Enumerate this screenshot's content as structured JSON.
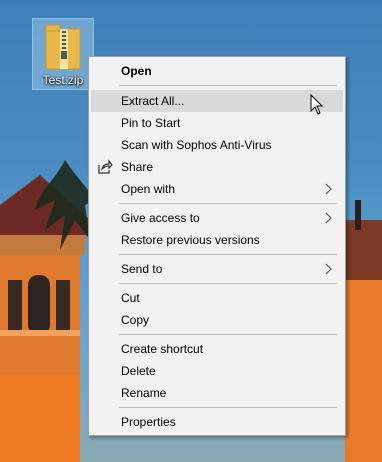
{
  "desktop": {
    "file": {
      "name": "Test.zip",
      "icon": "zip-folder-icon"
    }
  },
  "context_menu": {
    "items": [
      {
        "label": "Open",
        "bold": true
      },
      {
        "label": "Extract All...",
        "hover": true
      },
      {
        "label": "Pin to Start"
      },
      {
        "label": "Scan with Sophos Anti-Virus"
      },
      {
        "label": "Share",
        "icon": "share-icon"
      },
      {
        "label": "Open with",
        "submenu": true
      },
      {
        "label": "Give access to",
        "submenu": true
      },
      {
        "label": "Restore previous versions"
      },
      {
        "label": "Send to",
        "submenu": true
      },
      {
        "label": "Cut"
      },
      {
        "label": "Copy"
      },
      {
        "label": "Create shortcut"
      },
      {
        "label": "Delete"
      },
      {
        "label": "Rename"
      },
      {
        "label": "Properties"
      }
    ]
  },
  "colors": {
    "menu_bg": "#f2f2f2",
    "hover_bg": "#dadada",
    "separator": "#bdbdbd"
  }
}
